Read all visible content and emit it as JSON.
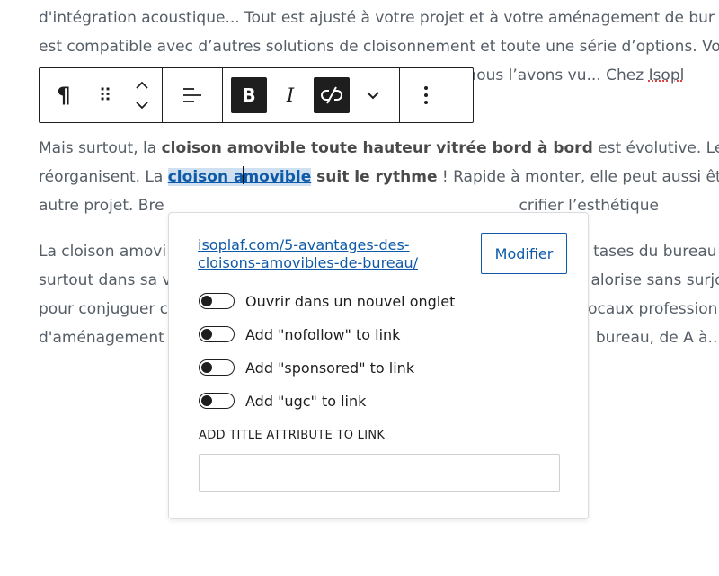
{
  "paragraphs": {
    "p1": {
      "line1": "d'intégration acoustique... Tout est ajusté à votre projet et à votre aménagement de bur",
      "line2": "est compatible avec d’autres solutions de cloisonnement et toute une série d’options. Vo",
      "line3_tail": "me nous l’avons vu... Chez ",
      "line3_spell": "Isopl"
    },
    "p2": {
      "l1_a": "Mais surtout, la ",
      "l1_b": "cloison amovible toute hauteur vitrée bord à bord",
      "l1_c": " est évolutive. Les e",
      "l2_a": "réorganisent. La ",
      "l2_link_a": "cloison a",
      "l2_link_b": "movible",
      "l2_bold": " suit le rythme",
      "l2_c": " ! Rapide à monter, elle peut aussi être",
      "l3_a": "autre projet. Bre",
      "l3_b": "crifier l’esthétique"
    },
    "p3": {
      "l1_a": "La cloison amovi",
      "l1_b": "tases du bureau d",
      "l2_a": "surtout dans sa v",
      "l2_b": "alorise sans surjo",
      "l3_a": "pour conjuguer c",
      "l3_b": "ocaux profession",
      "l4_a": "d'aménagement",
      "l4_b": "bureau, de A à..."
    }
  },
  "toolbar": {
    "paragraph_icon": "¶",
    "drag_icon": "⠿",
    "bold_label": "B",
    "italic_label": "I"
  },
  "popover": {
    "url": "isoplaf.com/5-avantages-des-cloisons-amovibles-de-bureau/",
    "modify_label": "Modifier",
    "toggles": [
      {
        "label": "Ouvrir dans un nouvel onglet",
        "on": false
      },
      {
        "label": "Add \"nofollow\" to link",
        "on": false
      },
      {
        "label": "Add \"sponsored\" to link",
        "on": false
      },
      {
        "label": "Add \"ugc\" to link",
        "on": false
      }
    ],
    "title_attr_label": "ADD TITLE ATTRIBUTE TO LINK",
    "title_attr_value": ""
  },
  "colors": {
    "link": "#0f5aa8",
    "toolbar_dark": "#1e1e1e",
    "text": "#555d66"
  }
}
